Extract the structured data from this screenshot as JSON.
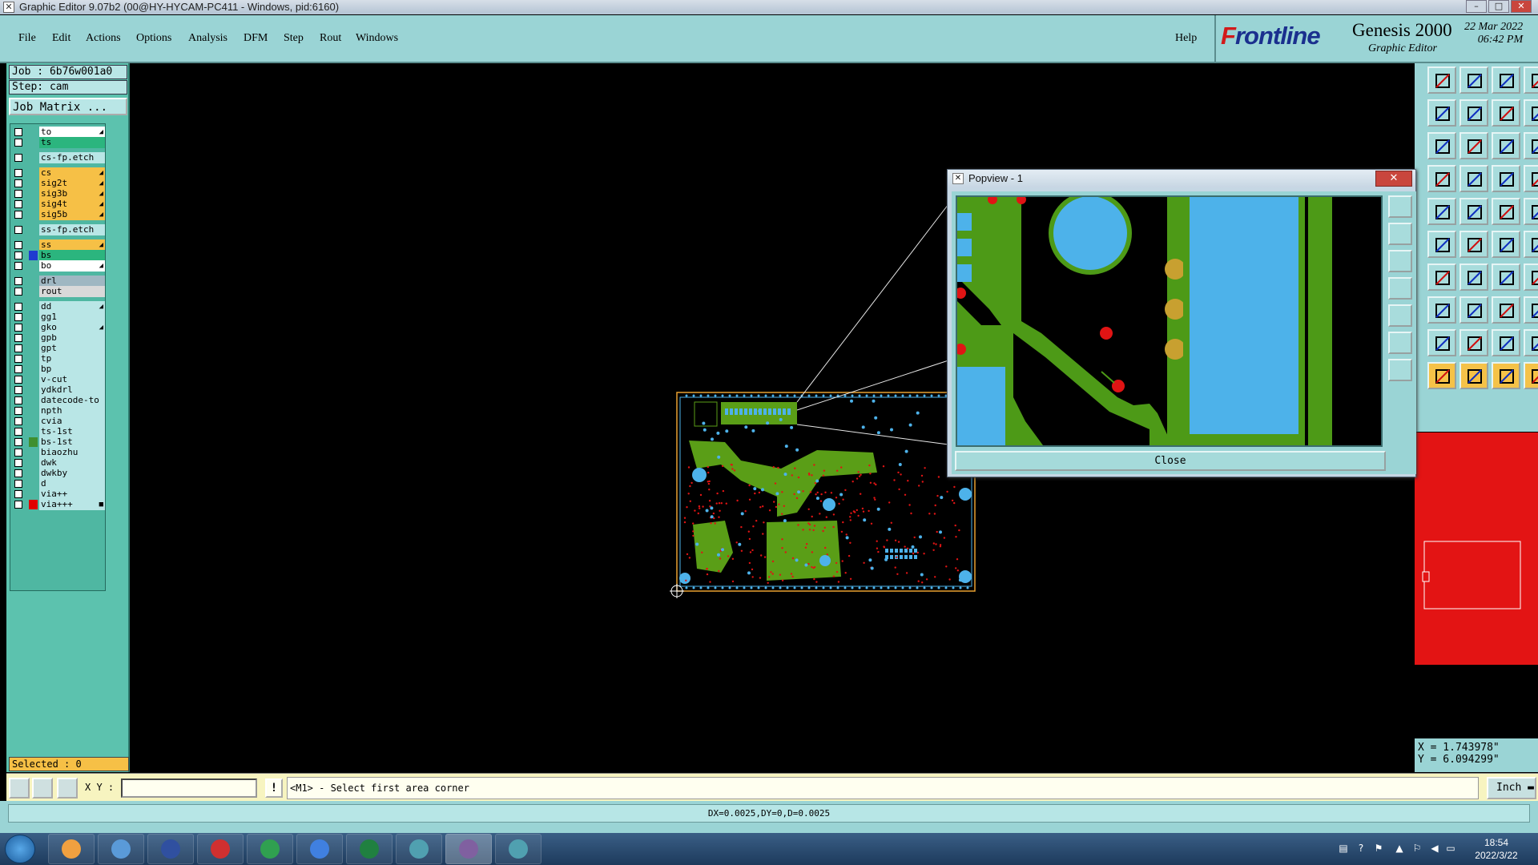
{
  "window": {
    "title": "Graphic Editor 9.07b2 (00@HY-HYCAM-PC411 - Windows, pid:6160)",
    "app_icon": "x-logo-icon",
    "controls": [
      "–",
      "□",
      "✕"
    ]
  },
  "menu": {
    "items": [
      "File",
      "Edit",
      "Actions",
      "Options",
      "Analysis",
      "DFM",
      "Step",
      "Rout",
      "Windows"
    ],
    "help": "Help"
  },
  "brand": {
    "logo_prefix": "F",
    "logo_rest": "rontline",
    "product": "Genesis 2000",
    "subtitle": "Graphic Editor",
    "date_line1": "22 Mar 2022",
    "date_line2": "06:42 PM"
  },
  "left_panel": {
    "job": "Job : 6b76w001a0",
    "step": "Step: cam",
    "job_matrix": "Job Matrix ...",
    "selected": "Selected : 0",
    "layers": [
      {
        "name": "to",
        "color": "#ffffff",
        "swatch": "",
        "mark": "◢"
      },
      {
        "name": "ts",
        "color": "#2bb57e",
        "swatch": "",
        "mark": ""
      },
      {
        "name": "cs-fp.etch",
        "color": "#b9e6e6",
        "swatch": "",
        "mark": ""
      },
      {
        "name": "cs",
        "color": "#f6c046",
        "swatch": "",
        "mark": "◢"
      },
      {
        "name": "sig2t",
        "color": "#f6c046",
        "swatch": "",
        "mark": "◢"
      },
      {
        "name": "sig3b",
        "color": "#f6c046",
        "swatch": "",
        "mark": "◢"
      },
      {
        "name": "sig4t",
        "color": "#f6c046",
        "swatch": "",
        "mark": "◢"
      },
      {
        "name": "sig5b",
        "color": "#f6c046",
        "swatch": "",
        "mark": "◢"
      },
      {
        "name": "ss-fp.etch",
        "color": "#b9e6e6",
        "swatch": "",
        "mark": ""
      },
      {
        "name": "ss",
        "color": "#f6c046",
        "swatch": "",
        "mark": "◢"
      },
      {
        "name": "bs",
        "color": "#2bb57e",
        "swatch": "#1f3bd0",
        "mark": ""
      },
      {
        "name": "bo",
        "color": "#ffffff",
        "swatch": "",
        "mark": "◢"
      },
      {
        "name": "drl",
        "color": "#9fb7c2",
        "swatch": "",
        "mark": ""
      },
      {
        "name": "rout",
        "color": "#d9d9d9",
        "swatch": "",
        "mark": ""
      },
      {
        "name": "dd",
        "color": "#b9e6e6",
        "swatch": "",
        "mark": "◢"
      },
      {
        "name": "gg1",
        "color": "#b9e6e6",
        "swatch": "",
        "mark": ""
      },
      {
        "name": "gko",
        "color": "#b9e6e6",
        "swatch": "",
        "mark": "◢"
      },
      {
        "name": "gpb",
        "color": "#b9e6e6",
        "swatch": "",
        "mark": ""
      },
      {
        "name": "gpt",
        "color": "#b9e6e6",
        "swatch": "",
        "mark": ""
      },
      {
        "name": "tp",
        "color": "#b9e6e6",
        "swatch": "",
        "mark": ""
      },
      {
        "name": "bp",
        "color": "#b9e6e6",
        "swatch": "",
        "mark": ""
      },
      {
        "name": "v-cut",
        "color": "#b9e6e6",
        "swatch": "",
        "mark": ""
      },
      {
        "name": "ydkdrl",
        "color": "#b9e6e6",
        "swatch": "",
        "mark": ""
      },
      {
        "name": "datecode-to",
        "color": "#b9e6e6",
        "swatch": "",
        "mark": ""
      },
      {
        "name": "npth",
        "color": "#b9e6e6",
        "swatch": "",
        "mark": ""
      },
      {
        "name": "cvia",
        "color": "#b9e6e6",
        "swatch": "",
        "mark": ""
      },
      {
        "name": "ts-1st",
        "color": "#b9e6e6",
        "swatch": "",
        "mark": ""
      },
      {
        "name": "bs-1st",
        "color": "#b9e6e6",
        "swatch": "#3f8f2f",
        "mark": ""
      },
      {
        "name": "biaozhu",
        "color": "#b9e6e6",
        "swatch": "",
        "mark": ""
      },
      {
        "name": "dwk",
        "color": "#b9e6e6",
        "swatch": "",
        "mark": ""
      },
      {
        "name": "dwkby",
        "color": "#b9e6e6",
        "swatch": "",
        "mark": ""
      },
      {
        "name": "d",
        "color": "#b9e6e6",
        "swatch": "",
        "mark": ""
      },
      {
        "name": "via++",
        "color": "#b9e6e6",
        "swatch": "",
        "mark": ""
      },
      {
        "name": "via+++",
        "color": "#b9e6e6",
        "swatch": "#e00000",
        "mark": "■"
      }
    ]
  },
  "popview": {
    "title": "Popview - 1",
    "close_x": "✕",
    "close_button": "Close"
  },
  "coords": {
    "x": "X = 1.743978\"",
    "y": "Y = 6.094299\""
  },
  "command": {
    "xy_label": "X Y :",
    "xy_value": "",
    "bang": "!",
    "prompt": "<M1> - Select first area corner",
    "unit": "Inch ▬"
  },
  "status": "DX=0.0025,DY=0,D=0.0025",
  "taskbar": {
    "time": "18:54",
    "date": "2022/3/22",
    "apps": [
      "app-shell-icon",
      "notepad-icon",
      "save-disk-icon",
      "genesis-icon",
      "fp-icon",
      "bird-icon",
      "excel-icon",
      "eye-icon",
      "x-app-icon",
      "eye-icon-2"
    ]
  },
  "colors": {
    "panel": "#9ad4d5",
    "layer_panel": "#5cc2ae",
    "copper": "#5a9e17",
    "pad": "#4db2ea",
    "via": "#e01414",
    "outline": "#e8a030"
  }
}
